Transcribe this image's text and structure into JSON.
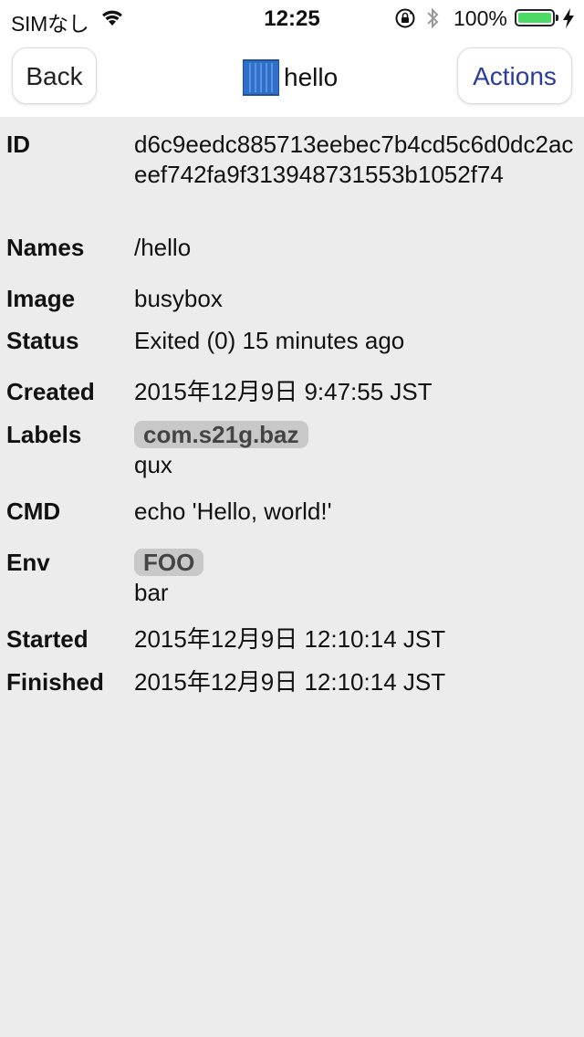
{
  "status_bar": {
    "carrier": "SIMなし",
    "time": "12:25",
    "battery_percent": "100%",
    "battery_level": 1.0,
    "wifi_icon": "wifi-icon",
    "lock_icon": "rotation-lock-icon",
    "bluetooth_icon": "bluetooth-icon",
    "charging_icon": "charging-bolt-icon"
  },
  "nav": {
    "back_label": "Back",
    "title": "hello",
    "title_icon": "container-icon",
    "actions_label": "Actions",
    "actions_color": "#2b3d9b"
  },
  "details": {
    "id_label": "ID",
    "id_value": "d6c9eedc885713eebec7b4cd5c6d0dc2aceef742fa9f313948731553b1052f74",
    "names_label": "Names",
    "names_value": "/hello",
    "image_label": "Image",
    "image_value": "busybox",
    "status_label": "Status",
    "status_value": "Exited (0) 15 minutes ago",
    "created_label": "Created",
    "created_value": "2015年12月9日 9:47:55 JST",
    "labels_label": "Labels",
    "labels_key": "com.s21g.baz",
    "labels_value": "qux",
    "cmd_label": "CMD",
    "cmd_value": "echo 'Hello, world!'",
    "env_label": "Env",
    "env_key": "FOO",
    "env_value": "bar",
    "started_label": "Started",
    "started_value": "2015年12月9日 12:10:14 JST",
    "finished_label": "Finished",
    "finished_value": "2015年12月9日 12:10:14 JST"
  },
  "colors": {
    "background": "#ececec",
    "chip_background": "#c8c8c8",
    "battery_fill": "#4cd964"
  }
}
